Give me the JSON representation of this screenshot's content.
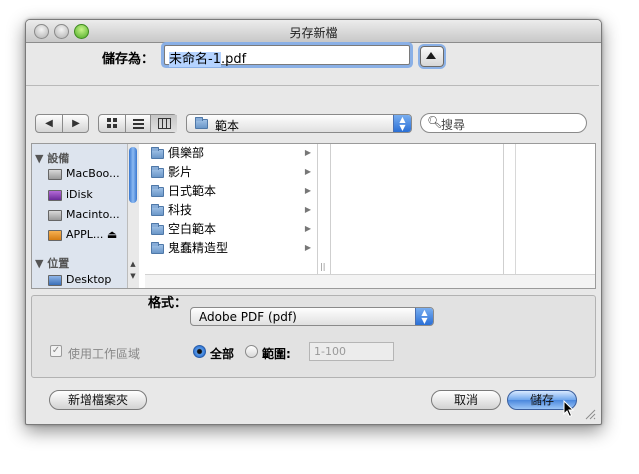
{
  "window": {
    "title": "另存新檔"
  },
  "save_as": {
    "label": "儲存為：",
    "filename_selected": "未命名-1",
    "filename_extension": ".pdf"
  },
  "toolbar": {
    "nav_back_icon": "chevron-left-icon",
    "nav_forward_icon": "chevron-right-icon",
    "view_modes": [
      "icon-view-icon",
      "list-view-icon",
      "column-view-icon"
    ],
    "location": "範本",
    "search_placeholder": "搜尋"
  },
  "sidebar": {
    "sections": [
      {
        "label": "設備"
      },
      {
        "label": "位置"
      }
    ],
    "devices": [
      {
        "label": "MacBoo...",
        "icon": "laptop-icon"
      },
      {
        "label": "iDisk",
        "icon": "idisk-icon"
      },
      {
        "label": "Macinto...",
        "icon": "hard-drive-icon"
      },
      {
        "label": "APPL...",
        "icon": "disk-icon",
        "eject": "⏏"
      }
    ],
    "places": [
      {
        "label": "Desktop",
        "icon": "desktop-icon"
      }
    ]
  },
  "column1": {
    "items": [
      {
        "label": "俱樂部"
      },
      {
        "label": "影片"
      },
      {
        "label": "日式範本"
      },
      {
        "label": "科技"
      },
      {
        "label": "空白範本"
      },
      {
        "label": "鬼蠢精造型"
      }
    ]
  },
  "options": {
    "format_label": "格式：",
    "format_value": "Adobe PDF (pdf)",
    "use_artboards_label": "使用工作區域",
    "use_artboards_checked": true,
    "use_artboards_enabled": false,
    "radio_all_label": "全部",
    "radio_range_label": "範圍:",
    "range_value": "1-100",
    "selected_radio": "all"
  },
  "buttons": {
    "new_folder": "新增檔案夾",
    "cancel": "取消",
    "save": "儲存"
  },
  "colors": {
    "accent": "#4b88dd",
    "focus_ring": "#8ab0e6",
    "selection": "#b5d3ff"
  }
}
